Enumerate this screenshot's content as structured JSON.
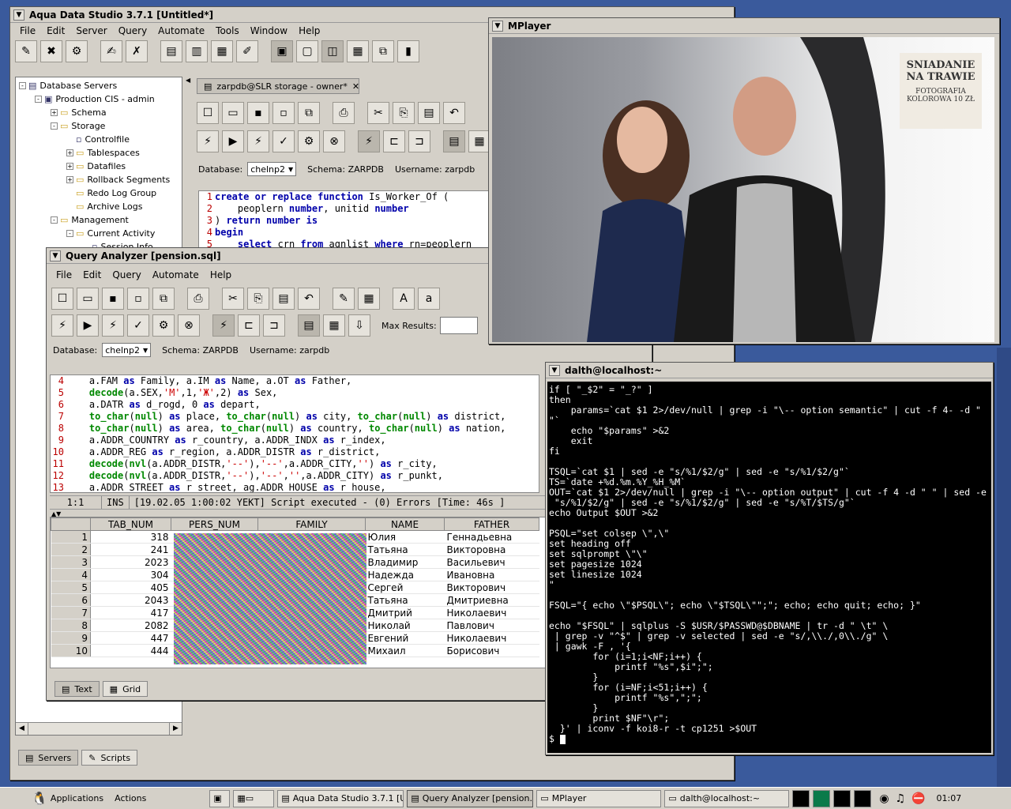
{
  "aqua": {
    "title": "Aqua Data Studio 3.7.1 [Untitled*]",
    "menu": [
      "File",
      "Edit",
      "Server",
      "Query",
      "Automate",
      "Tools",
      "Window",
      "Help"
    ],
    "tree": [
      {
        "label": "Database Servers",
        "level": 0,
        "exp": "-",
        "icon": "db"
      },
      {
        "label": "Production CIS - admin",
        "level": 1,
        "exp": "-",
        "icon": "server"
      },
      {
        "label": "Schema",
        "level": 2,
        "exp": "+",
        "icon": "folder"
      },
      {
        "label": "Storage",
        "level": 2,
        "exp": "-",
        "icon": "folder"
      },
      {
        "label": "Controlfile",
        "level": 3,
        "exp": "",
        "icon": "file"
      },
      {
        "label": "Tablespaces",
        "level": 3,
        "exp": "+",
        "icon": "folder"
      },
      {
        "label": "Datafiles",
        "level": 3,
        "exp": "+",
        "icon": "folder"
      },
      {
        "label": "Rollback Segments",
        "level": 3,
        "exp": "+",
        "icon": "folder"
      },
      {
        "label": "Redo Log Group",
        "level": 3,
        "exp": "",
        "icon": "folder"
      },
      {
        "label": "Archive Logs",
        "level": 3,
        "exp": "",
        "icon": "folder"
      },
      {
        "label": "Management",
        "level": 2,
        "exp": "-",
        "icon": "folder"
      },
      {
        "label": "Current Activity",
        "level": 3,
        "exp": "-",
        "icon": "folder"
      },
      {
        "label": "Session Info",
        "level": 4,
        "exp": "",
        "icon": "file"
      }
    ],
    "left_tabs": {
      "servers": "Servers",
      "scripts": "Scripts"
    },
    "doc_tab": "zarpdb@SLR storage - owner*",
    "db_label": "Database:",
    "db_value": "chelnp2",
    "schema": "Schema:  ZARPDB",
    "username": "Username:  zarpdb",
    "code": [
      {
        "n": "1",
        "t": "create or replace function Is_Worker_Of ("
      },
      {
        "n": "2",
        "t": "    peoplern number, unitid number"
      },
      {
        "n": "3",
        "t": ") return number is"
      },
      {
        "n": "4",
        "t": "begin"
      },
      {
        "n": "5",
        "t": "    select crn from agnlist where rn=peoplern"
      }
    ]
  },
  "query": {
    "title": "Query Analyzer [pension.sql]",
    "menu": [
      "File",
      "Edit",
      "Query",
      "Automate",
      "Help"
    ],
    "max_results": "Max Results:",
    "db_label": "Database:",
    "db_value": "chelnp2",
    "schema": "Schema:  ZARPDB",
    "username": "Username:  zarpdb",
    "code": [
      {
        "n": "4",
        "t": "    a.FAM as Family, a.IM as Name, a.OT as Father,"
      },
      {
        "n": "5",
        "t": "    decode(a.SEX,'M',1,'Ж',2) as Sex,"
      },
      {
        "n": "6",
        "t": "    a.DATR as d_rogd, 0 as depart,"
      },
      {
        "n": "7",
        "t": "    to_char(null) as place, to_char(null) as city, to_char(null) as district,"
      },
      {
        "n": "8",
        "t": "    to_char(null) as area, to_char(null) as country, to_char(null) as nation,"
      },
      {
        "n": "9",
        "t": "    a.ADDR_COUNTRY as r_country, a.ADDR_INDX as r_index,"
      },
      {
        "n": "10",
        "t": "    a.ADDR_REG as r_region, a.ADDR_DISTR as r_district,"
      },
      {
        "n": "11",
        "t": "    decode(nvl(a.ADDR_DISTR,'--'),'--',a.ADDR_CITY,'') as r_city,"
      },
      {
        "n": "12",
        "t": "    decode(nvl(a.ADDR_DISTR,'--'),'--','',a.ADDR_CITY) as r_punkt,"
      },
      {
        "n": "13",
        "t": "    a.ADDR_STREET as r_street, ag.ADDR_HOUSE as r_house,"
      }
    ],
    "status": {
      "pos": "1:1",
      "mode": "INS",
      "msg": "[19.02.05 1:00:02 YEKT]  Script executed - (0) Errors [Time: 46s ]"
    },
    "columns": [
      "TAB_NUM",
      "PERS_NUM",
      "FAMILY",
      "NAME",
      "FATHER"
    ],
    "rows": [
      {
        "rn": "1",
        "tab": "318",
        "name": "Юлия",
        "father": "Геннадьевна"
      },
      {
        "rn": "2",
        "tab": "241",
        "name": "Татьяна",
        "father": "Викторовна"
      },
      {
        "rn": "3",
        "tab": "2023",
        "name": "Владимир",
        "father": "Васильевич"
      },
      {
        "rn": "4",
        "tab": "304",
        "name": "Надежда",
        "father": "Ивановна"
      },
      {
        "rn": "5",
        "tab": "405",
        "name": "Сергей",
        "father": "Викторович"
      },
      {
        "rn": "6",
        "tab": "2043",
        "name": "Татьяна",
        "father": "Дмитриевна"
      },
      {
        "rn": "7",
        "tab": "417",
        "name": "Дмитрий",
        "father": "Николаевич"
      },
      {
        "rn": "8",
        "tab": "2082",
        "name": "Николай",
        "father": "Павлович"
      },
      {
        "rn": "9",
        "tab": "447",
        "name": "Евгений",
        "father": "Николаевич"
      },
      {
        "rn": "10",
        "tab": "444",
        "name": "Михаил",
        "father": "Борисович"
      }
    ],
    "result_tabs": {
      "text": "Text",
      "grid": "Grid"
    }
  },
  "mplayer": {
    "title": "MPlayer",
    "sign": [
      "SNIADANIE",
      "NA TRAWIE",
      "FOTOGRAFIA",
      "KOLOROWA  10 ZŁ"
    ]
  },
  "terminal": {
    "title": "dalth@localhost:~",
    "lines": [
      "if [ \"_$2\" = \"_?\" ]",
      "then",
      "    params=`cat $1 2>/dev/null | grep -i \"\\-- option semantic\" | cut -f 4- -d \"",
      "\"`",
      "    echo \"$params\" >&2",
      "    exit",
      "fi",
      "",
      "TSQL=`cat $1 | sed -e \"s/%1/$2/g\" | sed -e \"s/%1/$2/g\"`",
      "TS=`date +%d.%m.%Y_%H_%M`",
      "OUT=`cat $1 2>/dev/null | grep -i \"\\-- option output\" | cut -f 4 -d \" \" | sed -e",
      " \"s/%1/$2/g\" | sed -e \"s/%1/$2/g\" | sed -e \"s/%T/$TS/g\"`",
      "echo Output $OUT >&2",
      "",
      "PSQL=\"set colsep \\\",\\\"",
      "set heading off",
      "set sqlprompt \\\"\\\"",
      "set pagesize 1024",
      "set linesize 1024",
      "\"",
      "",
      "FSQL=\"{ echo \\\"$PSQL\\\"; echo \\\"$TSQL\\\"\";\"; echo; echo quit; echo; }\"",
      "",
      "echo \"$FSQL\" | sqlplus -S $USR/$PASSWD@$DBNAME | tr -d \" \\t\" \\",
      " | grep -v \"^$\" | grep -v selected | sed -e \"s/,\\\\./,0\\\\./g\" \\",
      " | gawk -F , '{",
      "        for (i=1;i<NF;i++) {",
      "            printf \"%s\",$i\";\";",
      "        }",
      "        for (i=NF;i<51;i++) {",
      "            printf \"%s\",\";\";",
      "        }",
      "        print $NF\"\\r\";",
      "  }' | iconv -f koi8-r -t cp1251 >$OUT",
      "$ "
    ]
  },
  "taskbar": {
    "applications": "Applications",
    "actions": "Actions",
    "tasks": [
      "Aqua Data Studio 3.7.1 [Unt",
      "Query Analyzer [pension.sql]",
      "MPlayer",
      "dalth@localhost:~"
    ],
    "clock": "01:07"
  }
}
